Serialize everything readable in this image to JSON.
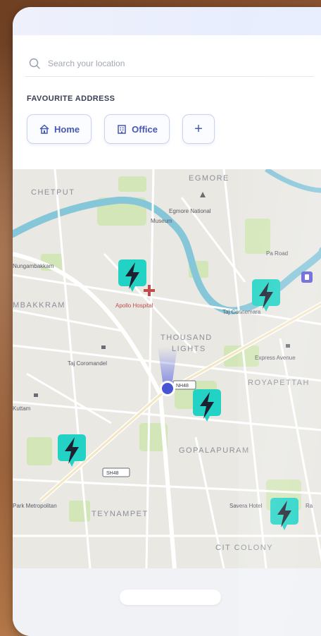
{
  "search": {
    "placeholder": "Search your location"
  },
  "favourites": {
    "title": "FAVOURITE ADDRESS",
    "chips": [
      {
        "label": "Home",
        "icon": "home-icon"
      },
      {
        "label": "Office",
        "icon": "office-building-icon"
      }
    ],
    "add_label": "+"
  },
  "map": {
    "areas": [
      "EGMORE",
      "CHETPUT",
      "MBAKKRAM",
      "THOUSAND",
      "LIGHTS",
      "ROYAPETTAH",
      "GOPALAPURAM",
      "TEYNAMPET",
      "CIT COLONY"
    ],
    "places": [
      "Egmore National",
      "Museum",
      "Apollo Hospital",
      "Taj Connemara",
      "Taj Coromandel",
      "Express Avenue",
      "Savera Hotel",
      "Park Metropolitan",
      "Nungambakkam",
      "Pa Road",
      "Kuttam",
      "Ra"
    ],
    "road_shields": [
      "NH48",
      "SH48"
    ],
    "charging_station_icon": "ev-charging-bolt-icon",
    "current_location_icon": "current-location-dot-icon"
  },
  "colors": {
    "accent": "#4657b4",
    "charger": "#22d3c5",
    "river": "#7fc4d8",
    "park": "#cfe3b3",
    "location_dot": "#4a55d6"
  }
}
